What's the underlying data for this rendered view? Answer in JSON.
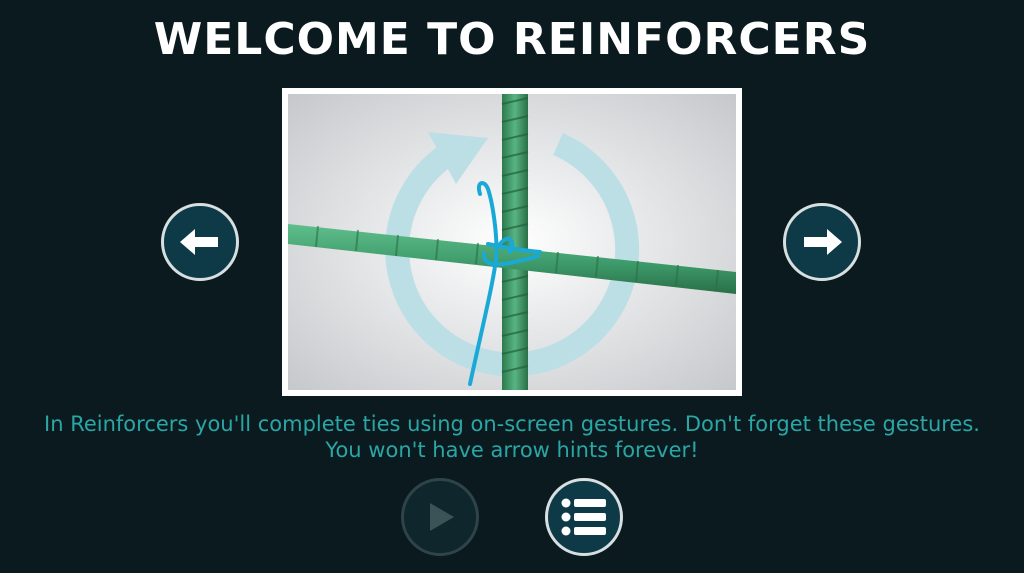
{
  "title": "WELCOME TO REINFORCERS",
  "instruction": "In Reinforcers you'll complete ties using on-screen gestures. Don't forget these gestures. You won't have arrow hints forever!",
  "tutorial_image": {
    "subject": "rebar-tie-gesture",
    "icons": [
      "rotate-arrow-icon",
      "rebar",
      "tie-wire"
    ]
  },
  "controls": {
    "prev_icon": "arrow-left-icon",
    "next_icon": "arrow-right-icon",
    "play_icon": "play-icon",
    "play_enabled": false,
    "menu_icon": "list-menu-icon"
  },
  "colors": {
    "background": "#0b1a1f",
    "button_fill": "#0e3a48",
    "button_border": "#d8dfe0",
    "instruction_text": "#2aa6a6",
    "rebar": "#3f9a6a",
    "wire": "#1aa9d6"
  }
}
